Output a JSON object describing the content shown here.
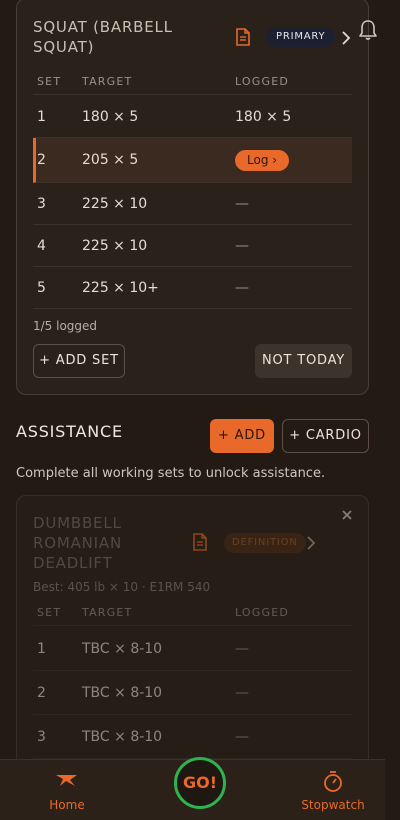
{
  "primary_exercise": {
    "title": "SQUAT (BARBELL SQUAT)",
    "tag": "PRIMARY",
    "headers": {
      "set": "SET",
      "target": "TARGET",
      "logged": "LOGGED"
    },
    "rows": [
      {
        "set": "1",
        "target": "180 × 5",
        "logged": "180 × 5"
      },
      {
        "set": "2",
        "target": "205 × 5",
        "logged": "Log ›",
        "active": true
      },
      {
        "set": "3",
        "target": "225 × 10",
        "logged": "—"
      },
      {
        "set": "4",
        "target": "225 × 10",
        "logged": "—"
      },
      {
        "set": "5",
        "target": "225 × 10+",
        "logged": "—"
      }
    ],
    "progress": "1/5 logged",
    "add_set_label": "+ ADD SET",
    "not_today_label": "NOT TODAY"
  },
  "assistance": {
    "title": "ASSISTANCE",
    "add_label": "+ ADD",
    "cardio_label": "+ CARDIO",
    "note": "Complete all working sets to unlock assistance."
  },
  "locked_exercise": {
    "title": "DUMBBELL ROMANIAN DEADLIFT",
    "tag": "DEFINITION",
    "best": "Best: 405 lb × 10 · E1RM 540",
    "headers": {
      "set": "SET",
      "target": "TARGET",
      "logged": "LOGGED"
    },
    "rows": [
      {
        "set": "1",
        "target": "TBC × 8-10",
        "logged": "—"
      },
      {
        "set": "2",
        "target": "TBC × 8-10",
        "logged": "—"
      },
      {
        "set": "3",
        "target": "TBC × 8-10",
        "logged": "—"
      }
    ]
  },
  "bottom_nav": {
    "home": "Home",
    "go": "GO!",
    "stopwatch": "Stopwatch"
  },
  "colors": {
    "accent": "#e8692a",
    "go_ring": "#2fb24f",
    "background": "#241a14",
    "card": "#2b211b"
  },
  "icons": [
    "bell-icon",
    "document-icon",
    "chevron-right-icon",
    "close-icon",
    "home-icon",
    "stopwatch-icon"
  ]
}
